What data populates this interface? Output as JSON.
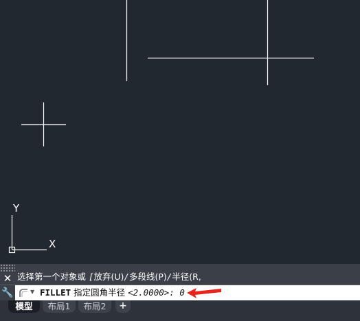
{
  "viewport": {
    "background": "#212830",
    "line_color": "#ffffff",
    "ucs": {
      "x_label": "X",
      "y_label": "Y"
    }
  },
  "command_history": {
    "prefix": "选择第一个对象或 ",
    "options_open": "[",
    "option_undo": "放弃(U)",
    "sep1": "/",
    "option_polyline": "多段线(P)",
    "sep2": "/",
    "option_radius": "半径(R,",
    "close_icon": "close-icon",
    "grip_icon": "grip-icon"
  },
  "command_line": {
    "command": "FILLET",
    "prompt": " 指定圆角半径 ",
    "default_value": "<2.0000>: ",
    "input_value": "0",
    "tool_icon": "wrench-icon",
    "command_icon": "fillet-icon",
    "arrow_color": "#e8251c"
  },
  "layout_tabs": {
    "tabs": [
      {
        "label": "模型",
        "active": true
      },
      {
        "label": "布局1",
        "active": false
      },
      {
        "label": "布局2",
        "active": false
      }
    ],
    "add_label": "+"
  }
}
